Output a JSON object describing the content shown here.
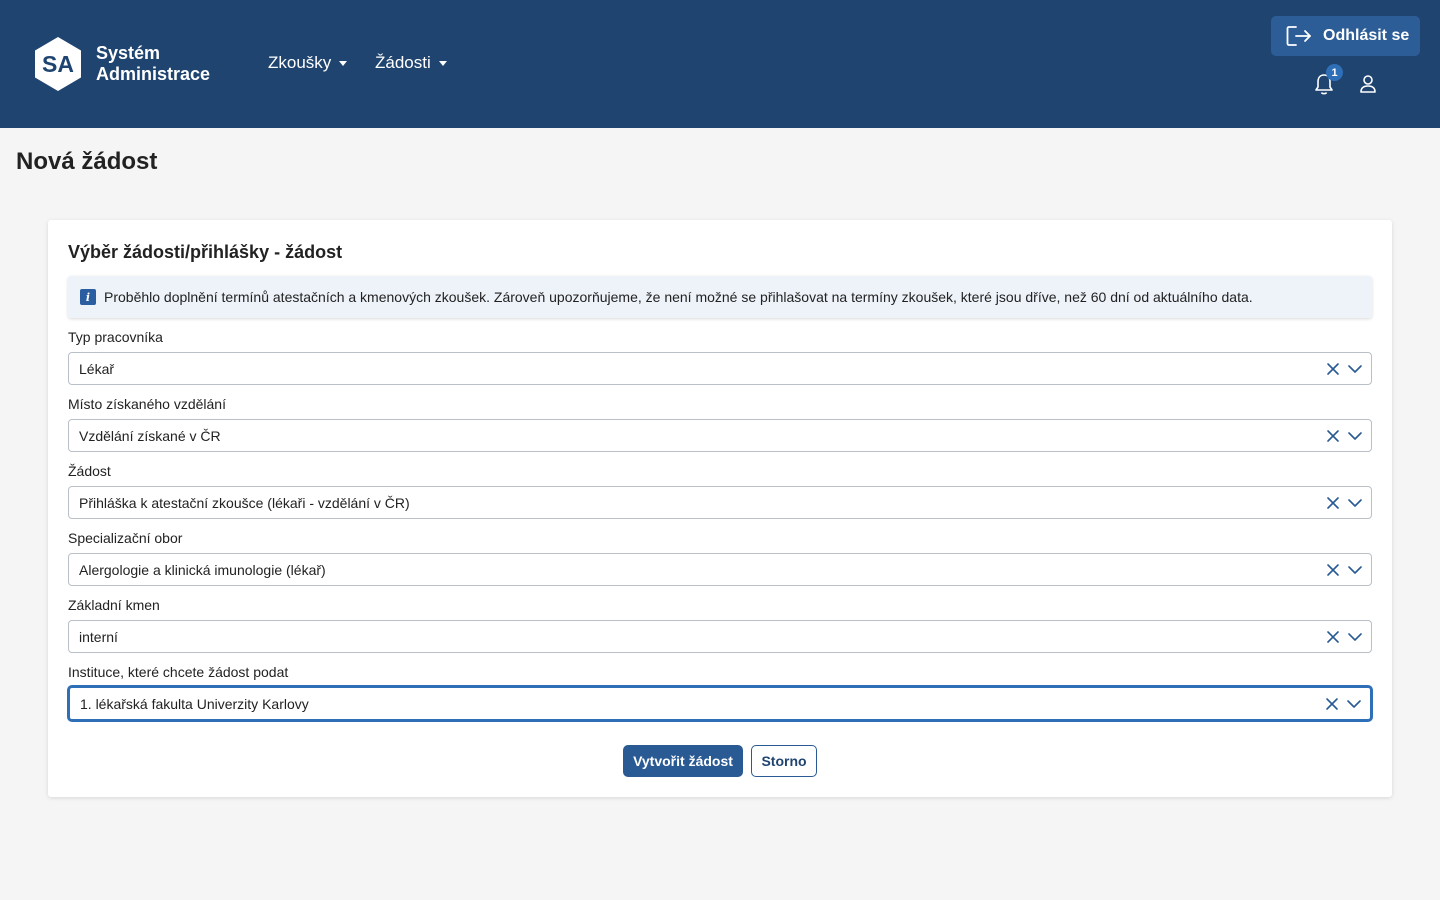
{
  "header": {
    "logo_abbr": "SA",
    "logo_line1": "Systém",
    "logo_line2": "Administrace",
    "nav": [
      {
        "label": "Zkoušky"
      },
      {
        "label": "Žádosti"
      }
    ],
    "logout_label": "Odhlásit se",
    "notification_count": "1",
    "colors": {
      "background": "#1f4470",
      "button": "#2c5d97"
    }
  },
  "page": {
    "title": "Nová žádost"
  },
  "card": {
    "title": "Výběr žádosti/přihlášky - žádost",
    "info_text": "Proběhlo doplnění termínů atestačních a kmenových zkoušek. Zároveň upozorňujeme, že není možné se přihlašovat na termíny zkoušek, které jsou dříve, než 60 dní od aktuálního data.",
    "fields": [
      {
        "label": "Typ pracovníka",
        "value": "Lékař"
      },
      {
        "label": "Místo získaného vzdělání",
        "value": "Vzdělání získané v ČR"
      },
      {
        "label": "Žádost",
        "value": "Přihláška k atestační zkoušce (lékaři - vzdělání v ČR)"
      },
      {
        "label": "Specializační obor",
        "value": "Alergologie a klinická imunologie (lékař)"
      },
      {
        "label": "Základní kmen",
        "value": "interní"
      },
      {
        "label": "Instituce, které chcete žádost podat",
        "value": "1. lékařská fakulta Univerzity Karlovy"
      }
    ],
    "submit_label": "Vytvořit žádost",
    "cancel_label": "Storno"
  },
  "icons": [
    "logo-hexagon-icon",
    "caret-down-icon",
    "logout-icon",
    "bell-icon",
    "user-icon",
    "info-icon",
    "clear-x-icon",
    "chevron-down-icon"
  ]
}
